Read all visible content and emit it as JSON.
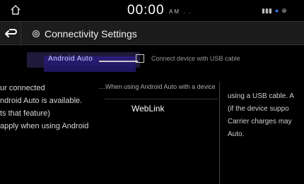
{
  "status_bar": {
    "time": "00:00",
    "time_suffix": "AM  . .",
    "right_icons": "III ● ⊕"
  },
  "header": {
    "title": "Connectivity Settings"
  },
  "row1": {
    "left_label": "Android Auto",
    "right_text": "Connect device with USB cable"
  },
  "left_text": {
    "line1": "ur connected",
    "line2": "ndroid Auto is available.",
    "line3": "ts that feature)",
    "line4": "apply when using Android"
  },
  "middle_top_text": "…When using Android Auto with a device",
  "webink_item": {
    "label": "WebLink"
  },
  "right_text": {
    "line1": "using a USB cable. A",
    "line2": "(if the device suppo",
    "line3": "Carrier charges may",
    "line4": "Auto."
  },
  "colors": {
    "accent": "#2b1e7a",
    "status_blue": "#3b7cff"
  }
}
